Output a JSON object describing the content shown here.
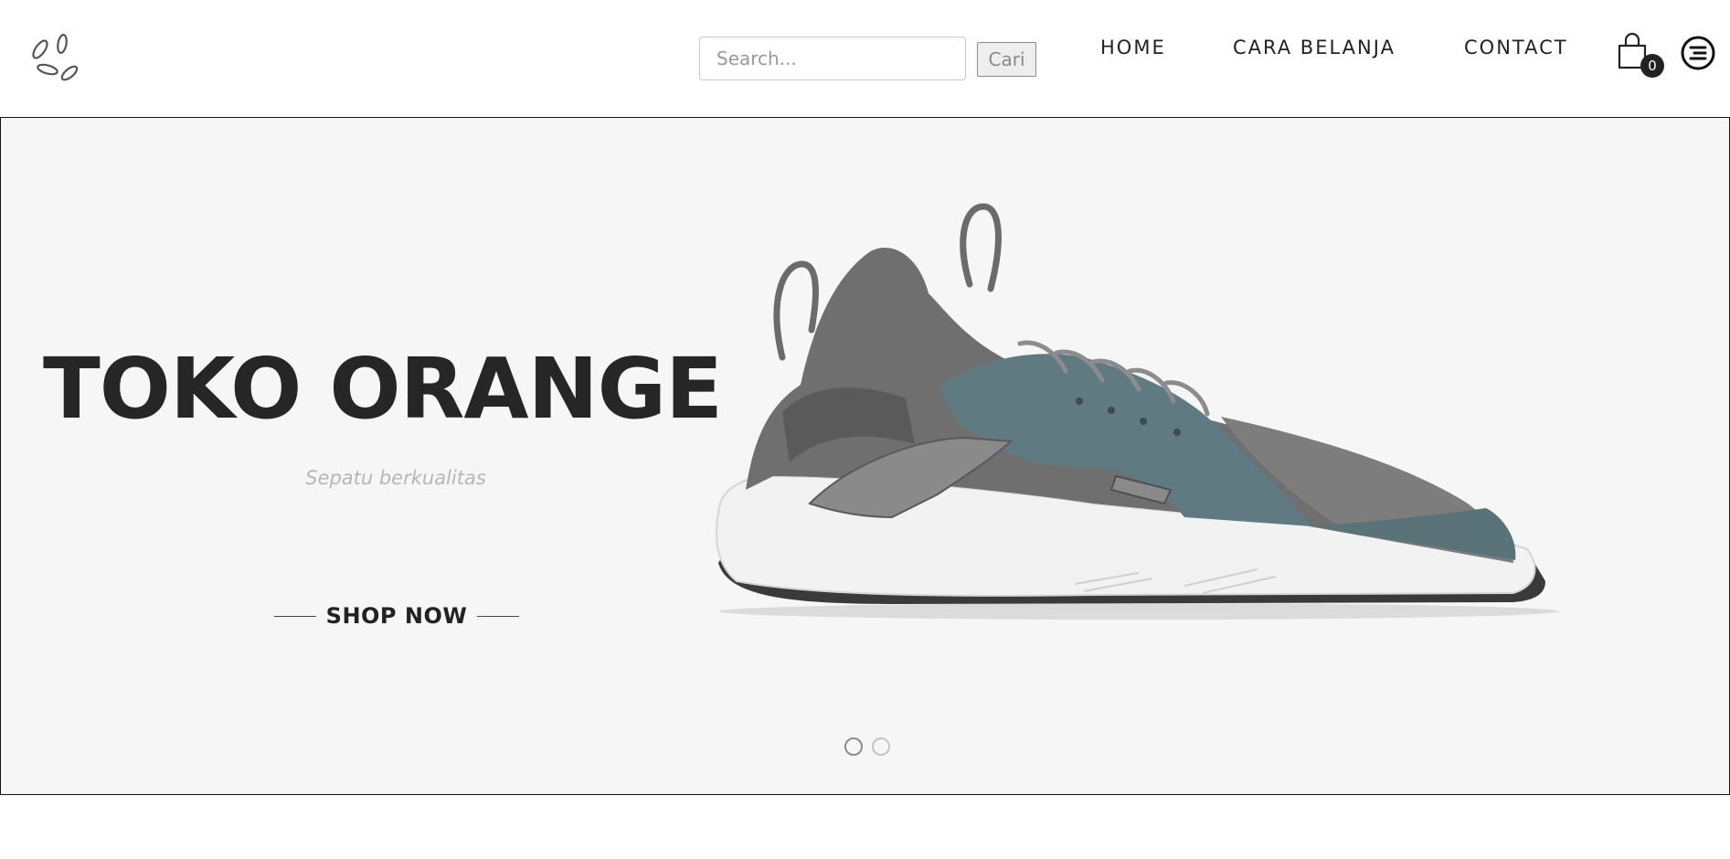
{
  "header": {
    "search": {
      "placeholder": "Search...",
      "value": ""
    },
    "search_button_label": "Cari",
    "nav": [
      {
        "label": "HOME"
      },
      {
        "label": "CARA BELANJA"
      },
      {
        "label": "CONTACT"
      }
    ],
    "cart_count": "0",
    "icons": {
      "logo": "leaf-logo-icon",
      "cart": "shopping-bag-icon",
      "menu": "menu-icon"
    }
  },
  "hero": {
    "title": "TOKO ORANGE",
    "subtitle": "Sepatu berkualitas",
    "cta_label": "SHOP NOW",
    "slides": 2,
    "active_slide": 1,
    "image": "sneaker-image"
  },
  "colors": {
    "text_dark": "#262626",
    "hero_background": "#f6f6f6",
    "subtitle": "#b6b6b6"
  }
}
